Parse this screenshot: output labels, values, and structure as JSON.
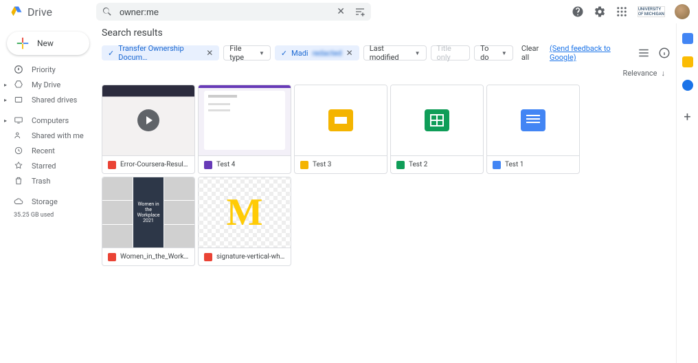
{
  "header": {
    "app_name": "Drive",
    "search_value": "owner:me",
    "org_label": "UNIVERSITY OF MICHIGAN"
  },
  "sidebar": {
    "new_label": "New",
    "items": [
      {
        "label": "Priority"
      },
      {
        "label": "My Drive"
      },
      {
        "label": "Shared drives"
      },
      {
        "label": "Computers"
      },
      {
        "label": "Shared with me"
      },
      {
        "label": "Recent"
      },
      {
        "label": "Starred"
      },
      {
        "label": "Trash"
      },
      {
        "label": "Storage"
      }
    ],
    "storage_used": "35.25 GB used"
  },
  "main": {
    "title": "Search results",
    "chips": {
      "transfer": "Transfer Ownership Docum…",
      "file_type": "File type",
      "person": "Madi",
      "last_modified": "Last modified",
      "title_only": "Title only",
      "todo": "To do",
      "clear_all": "Clear all",
      "feedback": "(Send feedback to Google)"
    },
    "sort": "Relevance",
    "files": [
      {
        "name": "Error-Coursera-Results.we…",
        "type": "video"
      },
      {
        "name": "Test 4",
        "type": "form"
      },
      {
        "name": "Test 3",
        "type": "slides"
      },
      {
        "name": "Test 2",
        "type": "sheets"
      },
      {
        "name": "Test 1",
        "type": "docs"
      },
      {
        "name": "Women_in_the_Workplace_…",
        "type": "pdf",
        "thumb_text": "Women in the Workplace 2021"
      },
      {
        "name": "signature-vertical-white.png",
        "type": "image"
      }
    ]
  }
}
